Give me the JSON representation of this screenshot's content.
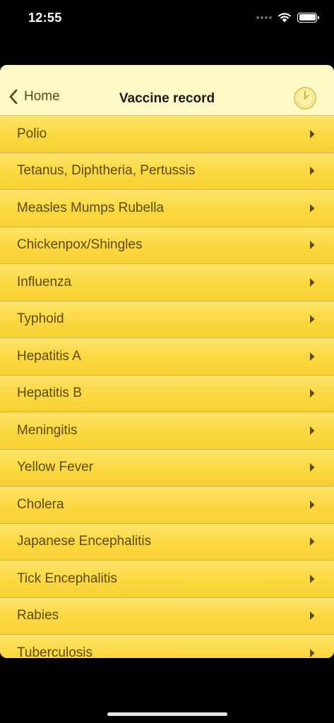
{
  "status_bar": {
    "time": "12:55"
  },
  "nav": {
    "back_label": "Home",
    "title": "Vaccine record",
    "right_icon": "clock-icon"
  },
  "colors": {
    "nav_background": "#fefac8",
    "list_background": "#fbd83e",
    "text": "#5b4a0c"
  },
  "vaccines": [
    "Polio",
    "Tetanus, Diphtheria, Pertussis",
    "Measles Mumps Rubella",
    "Chickenpox/Shingles",
    "Influenza",
    "Typhoid",
    "Hepatitis A",
    "Hepatitis B",
    "Meningitis",
    "Yellow Fever",
    "Cholera",
    "Japanese Encephalitis",
    "Tick Encephalitis",
    "Rabies",
    "Tuberculosis"
  ]
}
